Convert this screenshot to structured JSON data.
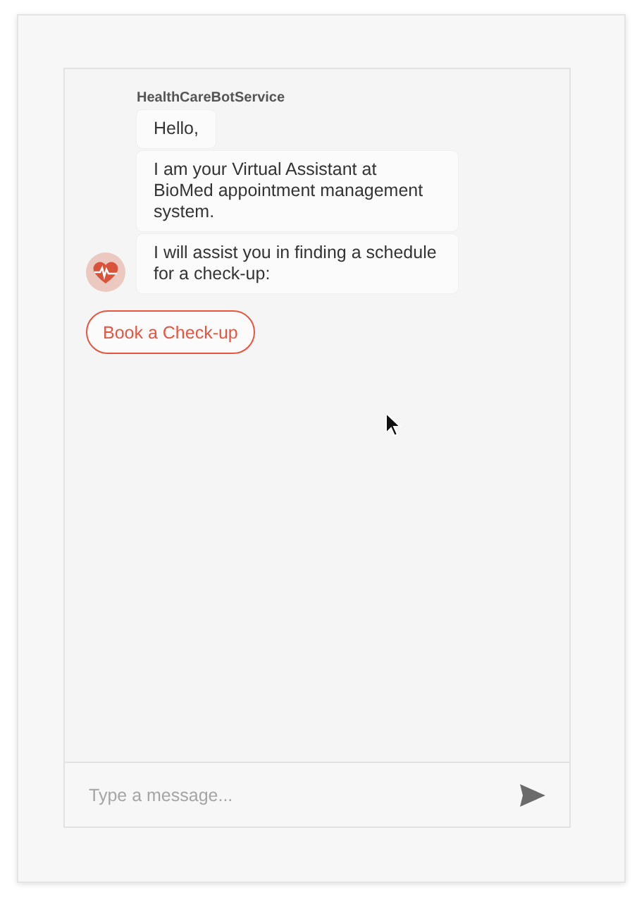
{
  "chat": {
    "sender": "HealthCareBotService",
    "messages": [
      {
        "text": "Hello,"
      },
      {
        "text": "I am your Virtual Assistant at BioMed appointment management system."
      },
      {
        "text": "I will assist you in finding a schedule for a check-up:"
      }
    ],
    "actions": [
      {
        "label": "Book a Check-up"
      }
    ]
  },
  "composer": {
    "placeholder": "Type a message..."
  }
}
